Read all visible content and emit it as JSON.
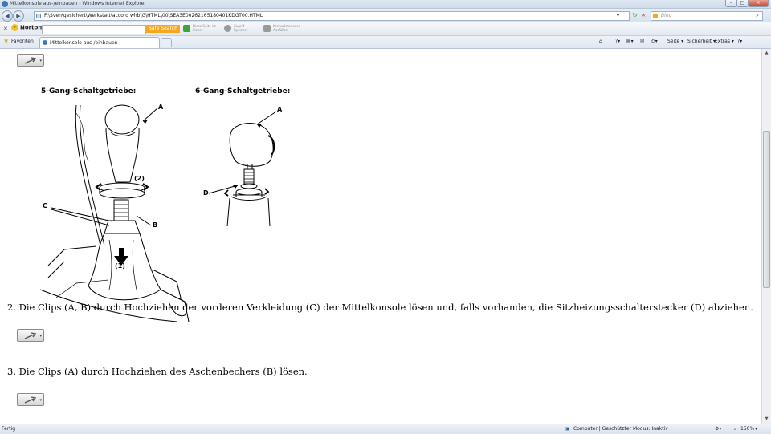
{
  "window": {
    "title": "Mittelkonsole aus-/einbauen - Windows Internet Explorer",
    "controls": [
      "–",
      "□",
      "×"
    ]
  },
  "address_bar": {
    "url": "F:\\Sven\\gesichert\\Werkstatt\\accord whb\\G\\HTML\\00\\SEA3E00262165180401KDGT00.HTML",
    "refresh": "↻",
    "stop": "×"
  },
  "search": {
    "placeholder": "Bing",
    "icon": "magnifier-icon"
  },
  "norton": {
    "logo": "Norton",
    "search_button": "Safe Search",
    "tools": [
      {
        "line1": "Diese Seite ist",
        "line2": "Sicher",
        "color": "#3aa63a"
      },
      {
        "line1": "Zugriff",
        "line2": "Speicher",
        "color": "#9a9a9a"
      },
      {
        "line1": "Kennwörter oder",
        "line2": "Ausfüllen",
        "color": "#9a9a9a"
      }
    ]
  },
  "favorites": {
    "label": "Favoriten"
  },
  "tab": {
    "title": "Mittelkonsole aus-/einbauen"
  },
  "commands": {
    "page": "Seite ▾",
    "security": "Sicherheit ▾",
    "extras": "Extras ▾",
    "help": "?▾"
  },
  "content": {
    "diagram": {
      "heading_5": "5-Gang-Schaltgetriebe:",
      "heading_6": "6-Gang-Schaltgetriebe:",
      "labels": {
        "a": "A",
        "b": "B",
        "c": "C",
        "d": "D",
        "n2": "(2)",
        "n1": "(1)"
      }
    },
    "steps": [
      "2. Die Clips (A, B) durch Hochziehen der vorderen Verkleidung (C) der Mittelkonsole lösen und, falls vorhanden, die Sitzheizungsschalterstecker (D) abziehen.",
      "3. Die Clips (A) durch Hochziehen des Aschenbechers (B) lösen."
    ]
  },
  "status": {
    "left": "Fertig",
    "zone": "Computer | Geschützter Modus: Inaktiv",
    "zoom": "150%"
  }
}
